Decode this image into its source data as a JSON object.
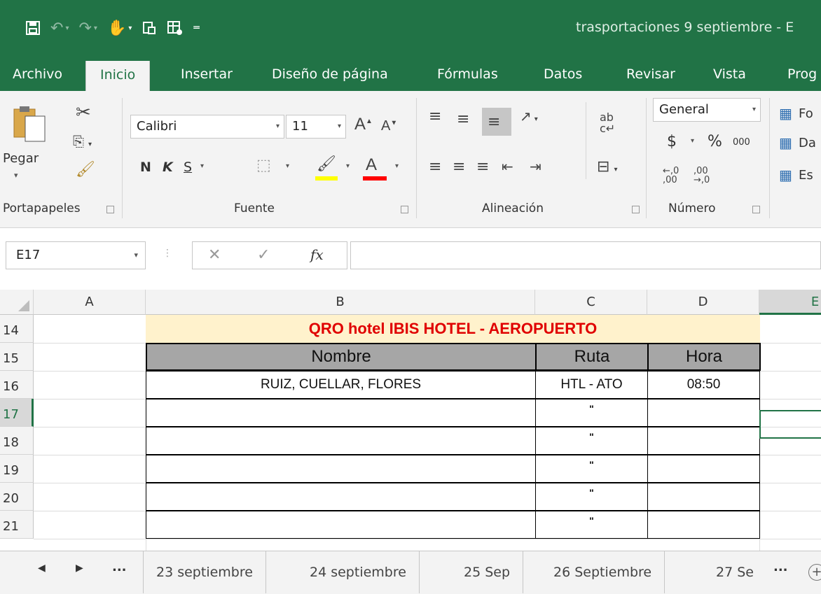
{
  "window": {
    "title": "trasportaciones 9 septiembre  -  E"
  },
  "quick_access": [
    {
      "icon": "save-icon"
    },
    {
      "icon": "undo-icon"
    },
    {
      "icon": "redo-icon"
    },
    {
      "icon": "touch-mode-icon"
    },
    {
      "icon": "print-preview-icon"
    },
    {
      "icon": "custom-icon"
    },
    {
      "icon": "customize-qat-icon"
    }
  ],
  "tabs": [
    "Archivo",
    "Inicio",
    "Insertar",
    "Diseño de página",
    "Fórmulas",
    "Datos",
    "Revisar",
    "Vista",
    "Prog"
  ],
  "active_tab": "Inicio",
  "ribbon": {
    "clipboard": {
      "paste_label": "Pegar",
      "group_label": "Portapapeles"
    },
    "font": {
      "name": "Calibri",
      "size": "11",
      "bold": "N",
      "italic": "K",
      "underline": "S",
      "group_label": "Fuente",
      "highlight_color": "#ffff00",
      "font_color": "#ff0000"
    },
    "alignment": {
      "group_label": "Alineación"
    },
    "number": {
      "format": "General",
      "currency": "$",
      "percent": "%",
      "thousands": "000",
      "group_label": "Número"
    },
    "styles": {
      "items": [
        "Fo",
        "Da",
        "Es"
      ]
    }
  },
  "formula_bar": {
    "name_box": "E17",
    "fx": "fx",
    "value": ""
  },
  "columns": [
    "A",
    "B",
    "C",
    "D",
    "E"
  ],
  "selected_column": "E",
  "rows": [
    "14",
    "15",
    "16",
    "17",
    "18",
    "19",
    "20",
    "21"
  ],
  "selected_row": "17",
  "sheet": {
    "title": "QRO hotel IBIS HOTEL - AEROPUERTO",
    "headers": [
      "Nombre",
      "Ruta",
      "Hora"
    ],
    "data": [
      [
        "RUIZ, CUELLAR, FLORES",
        "HTL - ATO",
        "08:50"
      ],
      [
        "",
        "\"",
        ""
      ],
      [
        "",
        "\"",
        ""
      ],
      [
        "",
        "\"",
        ""
      ],
      [
        "",
        "\"",
        ""
      ],
      [
        "",
        "\"",
        ""
      ]
    ]
  },
  "sheet_tabs": {
    "more": "...",
    "tabs": [
      "23 septiembre",
      "24 septiembre",
      "25 Sep",
      "26 Septiembre",
      "27 Se"
    ],
    "more_right": "...",
    "add": "+"
  },
  "colors": {
    "excel_green": "#217346",
    "title_fill": "#fff2cc",
    "title_text": "#e00000",
    "header_fill": "#a6a6a6"
  }
}
